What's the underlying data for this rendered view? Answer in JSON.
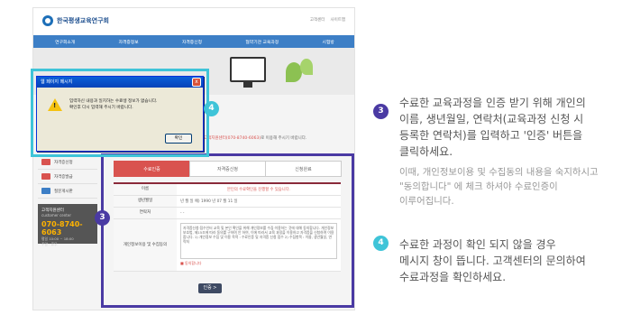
{
  "site": {
    "logo_text": "한국평생교육연구회",
    "util_links": [
      "고객센터",
      "사이트맵"
    ],
    "nav": [
      "연구회소개",
      "자격증정보",
      "자격증신청",
      "협약기관 교육과정",
      "시험방"
    ],
    "visual_caption": "",
    "sidebar": {
      "items": [
        "• 제출",
        "신청확인"
      ],
      "menu": [
        "자격증신청",
        "자격증발급",
        "질문게시판"
      ],
      "center": {
        "title": "고객지원센터",
        "subtitle": "customer center",
        "phone": "070-8740-6063",
        "hours": "평일 10:00 ~ 18:00",
        "closed": "주말 : 휴무"
      }
    },
    "notice": {
      "prefix": "고객지원센터(070-8740-6063)",
      "suffix": "로 이용해 주시기 바랍니다."
    },
    "steps": [
      "수료인증",
      "자격증신청",
      "신청완료"
    ],
    "active_step": 0,
    "form": {
      "name_label": "이름",
      "name_value": "본인의 수료확인을 진행할 수 있습니다.",
      "birth_label": "생년월일",
      "birth_value": "년 월 일  예) 1990 년 07 월 11 일",
      "contact_label": "연락처",
      "contact_value": "-  -",
      "privacy_label": "개인정보이용 및 수집동의",
      "privacy_text": "자격증신청·접수인터 교육 및 본인 확인을 위해 개인정보를 수집·이용하는 것에 대해 동의합니다. 개인정보 보호법, 제15조에 따라 동의를 구하며 안 하여, 이에 따라서 교육 과정을 이용하고 자격증을 신청하며 이용합니다. 1) 개인정보 수집 및 이용 목적 : 수료인증 및 자격증 신청 접수 2) 수집항목 : 이름, 생년월일, 연락처",
      "agree_label": "■ 동의합니다",
      "ok_button": "인증 >"
    },
    "dialog": {
      "title": "웹 페이지 메시지",
      "line1": "입력하신 내용과 일치하는 수료생 정보가 없습니다.",
      "line2": "확인후 다시 입력해 주시기 바랍니다.",
      "ok": "확인",
      "close": "x"
    }
  },
  "badges": {
    "dialog": "4",
    "form": "3"
  },
  "instructions": [
    {
      "number": "3",
      "color": "#4a3aa3",
      "lines": [
        "수료한 교육과정을 인증 받기 위해 개인의",
        "이름, 생년월일, 연락처(교육과정 신청 시",
        "등록한 연락처)를 입력하고 '인증' 버튼을",
        "클릭하세요."
      ],
      "note": [
        "이때, 개인정보이용 및 수집동의 내용을 숙지하시고",
        "\"동의합니다\" 에 체크 하셔야 수료인증이",
        "이루어집니다."
      ]
    },
    {
      "number": "4",
      "color": "#3fc4d8",
      "lines": [
        "수료한 과정이 확인 되지 않을 경우",
        "메시지 창이 뜹니다. 고객센터의 문의하여",
        "수료과정을 확인하세요."
      ]
    }
  ],
  "colors": {
    "accent_purple": "#4a3aa3",
    "accent_cyan": "#3fc4d8",
    "nav_blue": "#3d7fc6",
    "step_red": "#d9534f"
  }
}
